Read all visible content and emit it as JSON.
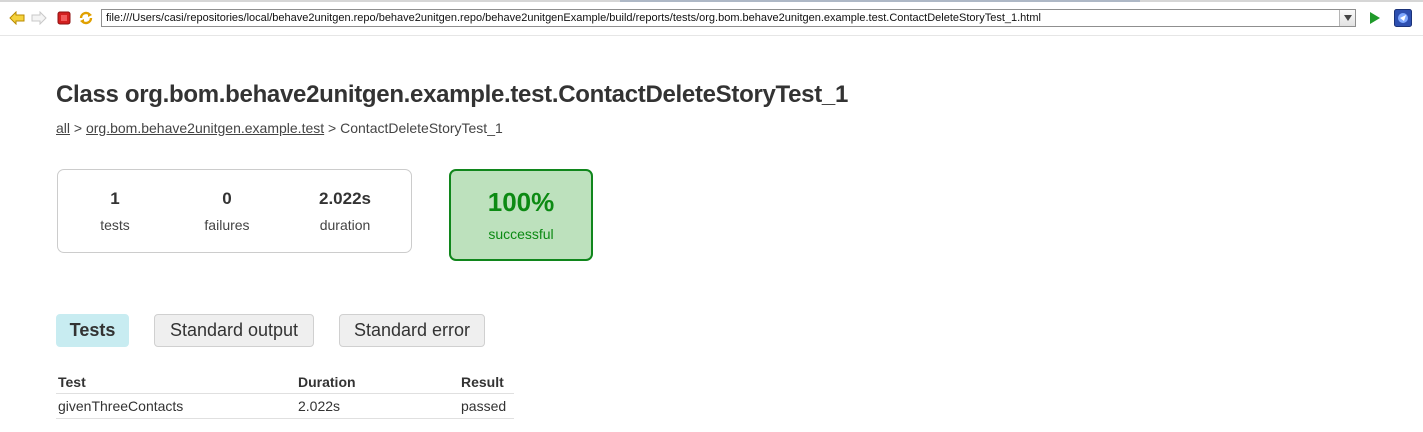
{
  "browser": {
    "url": "file:///Users/casi/repositories/local/behave2unitgen.repo/behave2unitgen.repo/behave2unitgenExample/build/reports/tests/org.bom.behave2unitgen.example.test.ContactDeleteStoryTest_1.html",
    "icons": [
      "back-arrow-icon",
      "forward-arrow-icon",
      "stop-icon",
      "refresh-icon",
      "dropdown-arrow-icon",
      "go-play-icon",
      "extension-icon"
    ],
    "colors": {
      "back_arrow": "#e0b400",
      "stop": "#d21f1f",
      "go": "#1f9a2a"
    }
  },
  "page": {
    "title": "Class org.bom.behave2unitgen.example.test.ContactDeleteStoryTest_1",
    "breadcrumb": {
      "all": "all",
      "sep1": ">",
      "package": "org.bom.behave2unitgen.example.test",
      "sep2": ">",
      "current": "ContactDeleteStoryTest_1"
    }
  },
  "summary": {
    "tests": {
      "value": "1",
      "label": "tests"
    },
    "failures": {
      "value": "0",
      "label": "failures"
    },
    "duration": {
      "value": "2.022s",
      "label": "duration"
    },
    "success_rate": {
      "value": "100%",
      "label": "successful"
    }
  },
  "tabs": [
    {
      "label": "Tests",
      "selected": true
    },
    {
      "label": "Standard output",
      "selected": false
    },
    {
      "label": "Standard error",
      "selected": false
    }
  ],
  "table": {
    "headers": [
      "Test",
      "Duration",
      "Result"
    ],
    "rows": [
      {
        "test": "givenThreeContacts",
        "duration": "2.022s",
        "result": "passed"
      }
    ]
  },
  "colors": {
    "success_green": "#0c8a13",
    "success_bg": "#bde1bd",
    "selected_tab_bg": "#c8ecf1",
    "text": "#333333"
  }
}
